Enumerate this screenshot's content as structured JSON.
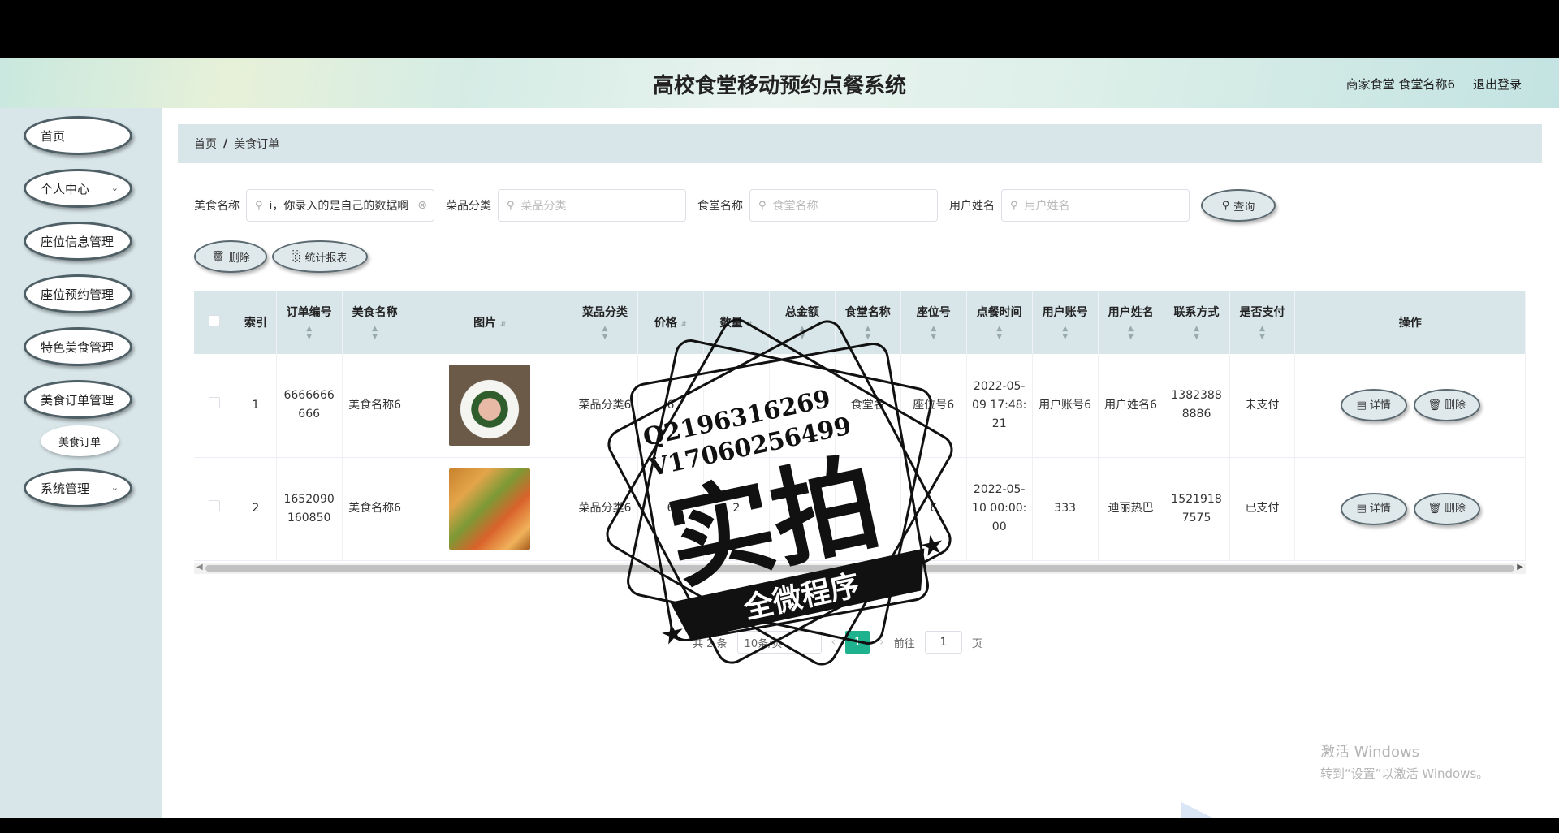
{
  "header": {
    "title": "高校食堂移动预约点餐系统",
    "user_label": "商家食堂 食堂名称6",
    "logout": "退出登录"
  },
  "sidebar": {
    "items": [
      {
        "label": "首页",
        "has_chevron": false
      },
      {
        "label": "个人中心",
        "has_chevron": true
      },
      {
        "label": "座位信息管理",
        "has_chevron": false
      },
      {
        "label": "座位预约管理",
        "has_chevron": false
      },
      {
        "label": "特色美食管理",
        "has_chevron": false
      },
      {
        "label": "美食订单管理",
        "has_chevron": false
      },
      {
        "label": "系统管理",
        "has_chevron": true
      }
    ],
    "submenu_item": "美食订单"
  },
  "breadcrumb": {
    "home": "首页",
    "separator": "/",
    "current": "美食订单"
  },
  "search": {
    "food_name_label": "美食名称",
    "food_name_value": "i，你录入的是自己的数据啊",
    "category_label": "菜品分类",
    "category_placeholder": "菜品分类",
    "canteen_label": "食堂名称",
    "canteen_placeholder": "食堂名称",
    "user_label": "用户姓名",
    "user_placeholder": "用户姓名",
    "query_button": "查询"
  },
  "actions": {
    "delete_button": "删除",
    "report_button": "统计报表"
  },
  "table": {
    "headers": [
      "索引",
      "订单编号",
      "美食名称",
      "图片",
      "菜品分类",
      "价格",
      "数量",
      "总金额",
      "食堂名称",
      "座位号",
      "点餐时间",
      "用户账号",
      "用户姓名",
      "联系方式",
      "是否支付",
      "操作"
    ],
    "rows": [
      {
        "index": "1",
        "order_no": "6666666666",
        "food_name": "美食名称6",
        "category": "菜品分类6",
        "price": "6",
        "quantity": "",
        "total": "",
        "canteen": "食堂名",
        "seat": "座位号6",
        "time": "2022-05-09 17:48:21",
        "account": "用户账号6",
        "user": "用户姓名6",
        "phone": "13823888886",
        "paid": "未支付"
      },
      {
        "index": "2",
        "order_no": "1652090160850",
        "food_name": "美食名称6",
        "category": "菜品分类6",
        "price": "6",
        "quantity": "2",
        "total": "",
        "canteen": "",
        "seat": "6",
        "time": "2022-05-10 00:00:00",
        "account": "333",
        "user": "迪丽热巴",
        "phone": "15219187575",
        "paid": "已支付"
      }
    ],
    "detail_button": "详情",
    "delete_button": "删除"
  },
  "pagination": {
    "total": "共 2 条",
    "page_size": "10条/页",
    "current_page": "1",
    "goto_label": "前往",
    "goto_value": "1",
    "page_suffix": "页"
  },
  "stamp": {
    "qq": "Q2196316269",
    "vx": "V17060256499",
    "big_text": "实拍",
    "banner_text": "全微程序"
  },
  "watermark": {
    "line1": "激活 Windows",
    "line2": "转到“设置”以激活 Windows。"
  },
  "colors": {
    "accent": "#1fb28f",
    "sidebar_bg": "#d8e6ea",
    "pill_border": "#4f5f66"
  }
}
